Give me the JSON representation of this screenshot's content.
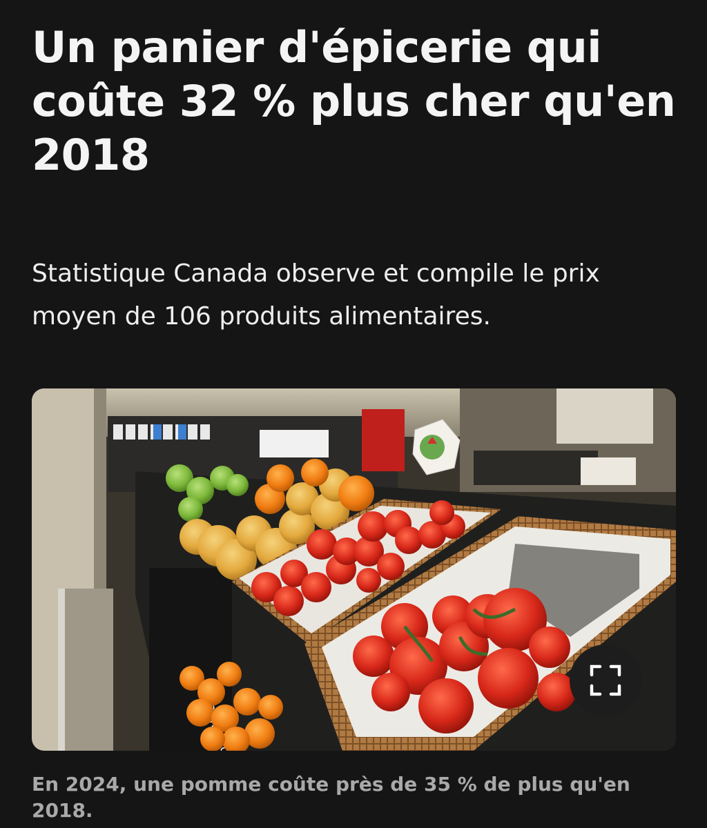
{
  "article": {
    "headline": "Un panier d'épicerie qui coûte 32 % plus cher qu'en 2018",
    "subheadline": "Statistique Canada observe et compile le prix moyen de 106 produits alimentaires.",
    "image": {
      "description_icon": "photo-grocery-produce",
      "expand_icon": "fullscreen-expand-icon"
    },
    "caption": "En 2024, une pomme coûte près de 35 % de plus qu'en 2018."
  },
  "colors": {
    "background": "#151515",
    "headline": "#f4f4f4",
    "caption": "#a9a9a9"
  }
}
